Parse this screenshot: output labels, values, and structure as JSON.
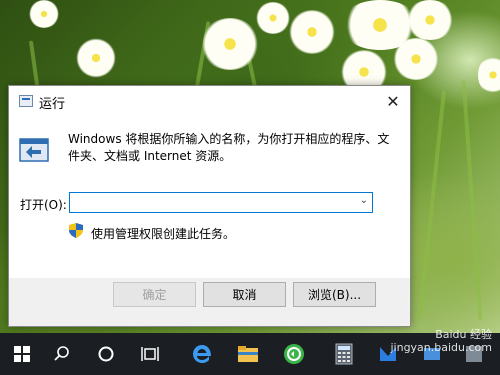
{
  "dialog": {
    "title": "运行",
    "close_glyph": "✕",
    "description": "Windows 将根据你所输入的名称，为你打开相应的程序、文件夹、文档或 Internet 资源。",
    "open_label": "打开(O):",
    "open_value": "",
    "admin_note": "使用管理权限创建此任务。",
    "buttons": {
      "ok": "确定",
      "cancel": "取消",
      "browse": "浏览(B)..."
    }
  },
  "watermark": {
    "logo": "Baidu 经验",
    "url": "jingyan.baidu.com"
  },
  "taskbar": {
    "items": [
      "start",
      "search",
      "cortana",
      "task-view",
      "edge",
      "file-explorer",
      "360-browser",
      "calculator",
      "app",
      "app",
      "app"
    ]
  },
  "colors": {
    "taskbar": "#1b1f24",
    "accent": "#0078d7"
  }
}
